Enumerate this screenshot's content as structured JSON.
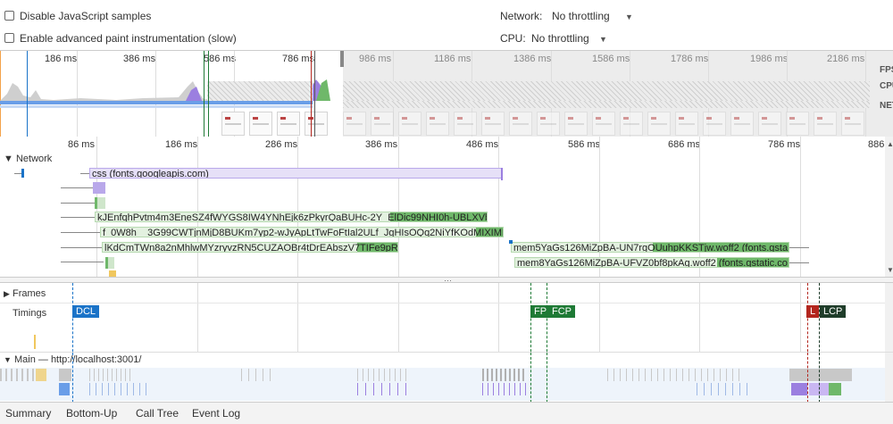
{
  "settings": {
    "disable_js_label": "Disable JavaScript samples",
    "paint_instr_label": "Enable advanced paint instrumentation (slow)",
    "network_label": "Network:",
    "network_value": "No throttling",
    "cpu_label": "CPU:",
    "cpu_value": "No throttling"
  },
  "overview": {
    "ticks": [
      "186 ms",
      "386 ms",
      "586 ms",
      "786 ms",
      "986 ms",
      "1186 ms",
      "1386 ms",
      "1586 ms",
      "1786 ms",
      "1986 ms",
      "2186 ms"
    ],
    "side_labels": [
      "FPS",
      "CPU",
      "NET"
    ]
  },
  "ruler": {
    "ticks": [
      "86 ms",
      "186 ms",
      "286 ms",
      "386 ms",
      "486 ms",
      "586 ms",
      "686 ms",
      "786 ms",
      "886"
    ]
  },
  "network": {
    "title": "Network",
    "requests": [
      {
        "label": "css (fonts.googleapis.com)"
      },
      {
        "label": "kJEnfqhPvtm4m3EneSZ4fWYGS8IW4YNhEjk6zPkyrQaBUHc-2Y_ElDic99NHI0h-UBLXVbRCj..."
      },
      {
        "label": "f_0W8h__3G99CWTjnMjD8BUKm7yp2-wJyApLtTwFoFtIal2ULf_JgHIsOQq2NiYfKOdMIXIMHDK..."
      },
      {
        "label": "lKdCmTWn8a2nMhlwMYzryvzRN5CUZAOBr4tDrEAbszV7TIFe9pRAI..."
      },
      {
        "label": "mem5YaGs126MiZpBA-UN7rgOUuhpKKSTjw.woff2 (fonts.gsta..."
      },
      {
        "label": "mem8YaGs126MiZpBA-UFVZ0bf8pkAg.woff2 (fonts.gstatic.co..."
      }
    ]
  },
  "frames": {
    "title": "Frames"
  },
  "timings": {
    "title": "Timings",
    "markers": [
      {
        "label": "DCL",
        "color": "#1a73c8"
      },
      {
        "label": "FP",
        "color": "#1e7a35"
      },
      {
        "label": "FCP",
        "color": "#1e7a35"
      },
      {
        "label": "L",
        "color": "#b3261e"
      },
      {
        "label": "LCP",
        "color": "#1f3d2a"
      }
    ]
  },
  "main": {
    "title": "Main — http://localhost:3001/"
  },
  "bottom_tabs": [
    "Summary",
    "Bottom-Up",
    "Call Tree",
    "Event Log"
  ],
  "colors": {
    "scripting": "#f0c75e",
    "rendering": "#9b7fe0",
    "painting": "#6fb86a",
    "loading": "#6a9ee8",
    "idle": "#c8c8c8"
  }
}
